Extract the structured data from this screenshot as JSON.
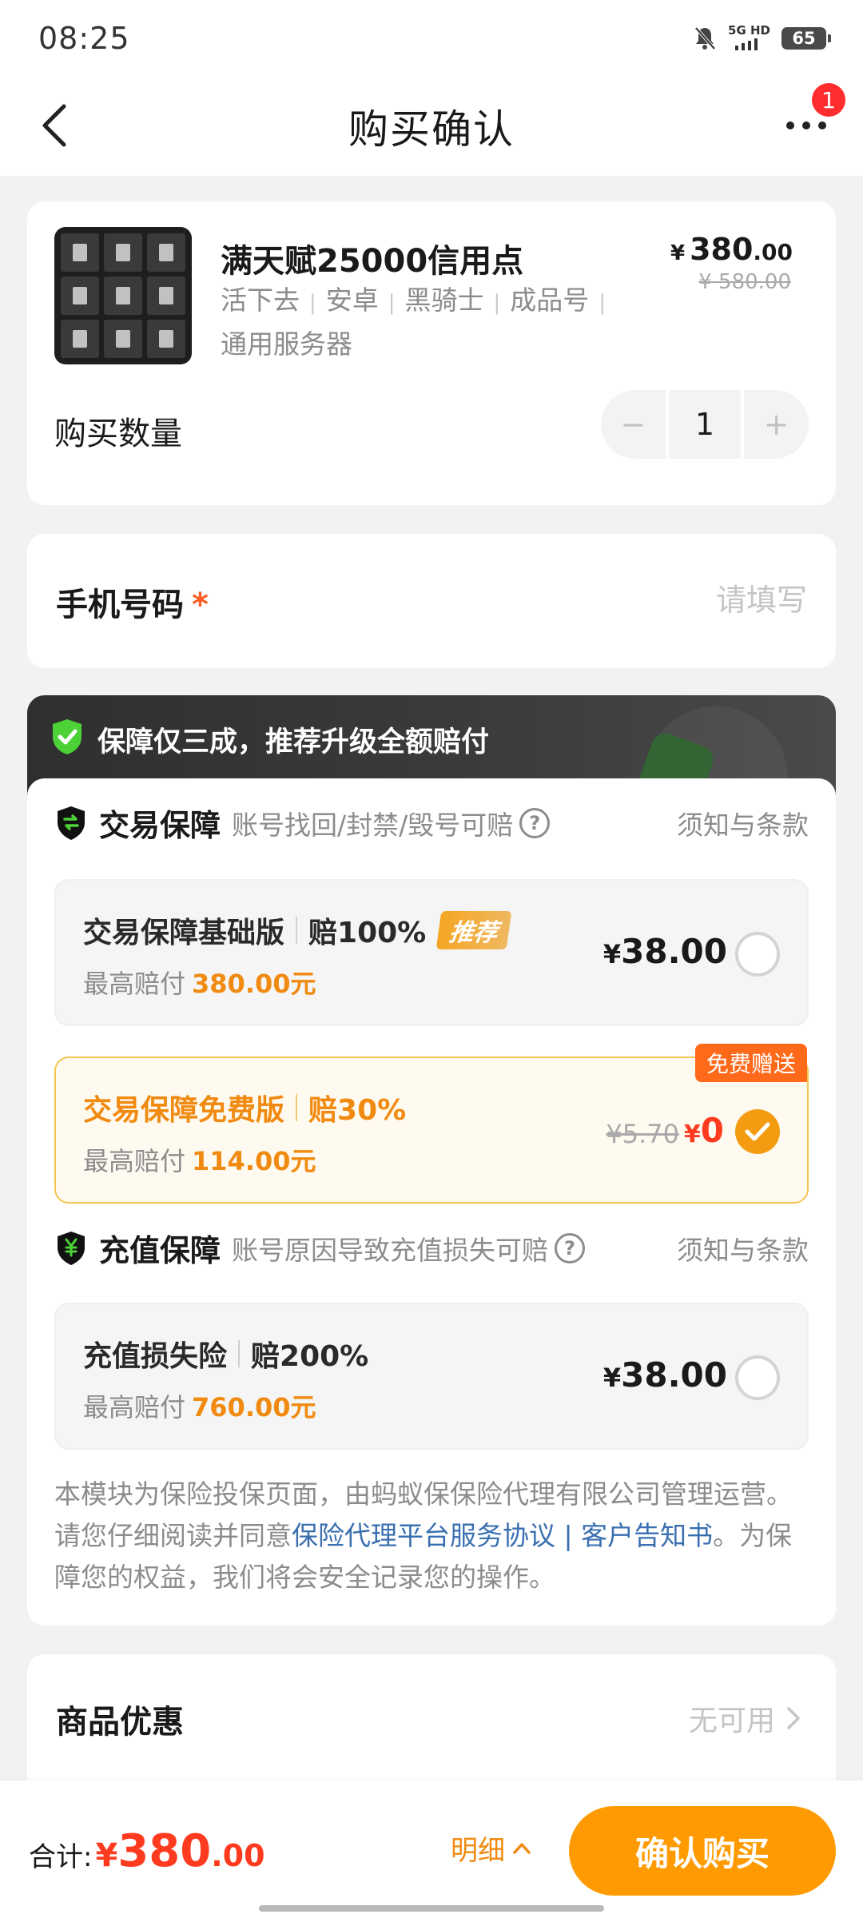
{
  "status_bar": {
    "time": "08:25",
    "network": "5G HD",
    "battery": "65"
  },
  "nav": {
    "title": "购买确认",
    "badge_count": "1",
    "icons": {
      "back": "chevron-left-icon",
      "more": "more-dots-icon"
    }
  },
  "product": {
    "name": "满天赋25000信用点",
    "tags": [
      "活下去",
      "安卓",
      "黑骑士",
      "成品号",
      "通用服务器"
    ],
    "price_currency": "¥",
    "price_int": "380",
    "price_dec": ".00",
    "original_price": "¥ 580.00",
    "quantity_label": "购买数量",
    "quantity": "1",
    "minus": "−",
    "plus": "+"
  },
  "phone": {
    "label": "手机号码",
    "required": "*",
    "placeholder": "请填写"
  },
  "insurance": {
    "banner": "保障仅三成，推荐升级全额赔付",
    "trade": {
      "title": "交易保障",
      "subtitle": "账号找回/封禁/毁号可赔",
      "terms": "须知与条款",
      "plans": [
        {
          "name": "交易保障基础版",
          "rate": "赔100%",
          "tag": "推荐",
          "max_label": "最高赔付",
          "max_amount": "380.00元",
          "price_cur": "¥",
          "price": "38.00",
          "selected": false
        },
        {
          "name": "交易保障免费版",
          "rate": "赔30%",
          "gift": "免费赠送",
          "max_label": "最高赔付",
          "max_amount": "114.00元",
          "old_price": "¥5.70",
          "price_cur": "¥",
          "price": "0",
          "selected": true
        }
      ]
    },
    "recharge": {
      "title": "充值保障",
      "subtitle": "账号原因导致充值损失可赔",
      "terms": "须知与条款",
      "plans": [
        {
          "name": "充值损失险",
          "rate": "赔200%",
          "max_label": "最高赔付",
          "max_amount": "760.00元",
          "price_cur": "¥",
          "price": "38.00",
          "selected": false
        }
      ]
    },
    "notice": {
      "text1": "本模块为保险投保页面，由蚂蚁保保险代理有限公司管理运营。请您仔细阅读并同意",
      "link1": "保险代理平台服务协议",
      "link_sep": " | ",
      "link2": "客户告知书",
      "text2": "。为保障您的权益，我们将会安全记录您的操作。"
    }
  },
  "discount": {
    "label": "商品优惠",
    "value": "无可用"
  },
  "bottom": {
    "total_label": "合计:",
    "total_cur": "¥",
    "total_int": "380",
    "total_dec": ".00",
    "detail": "明细",
    "confirm": "确认购买"
  },
  "colors": {
    "accent_orange": "#ff9b00",
    "price_red": "#ff3b1f",
    "link_blue": "#3a6fb0",
    "shield_green": "#4cd137"
  }
}
